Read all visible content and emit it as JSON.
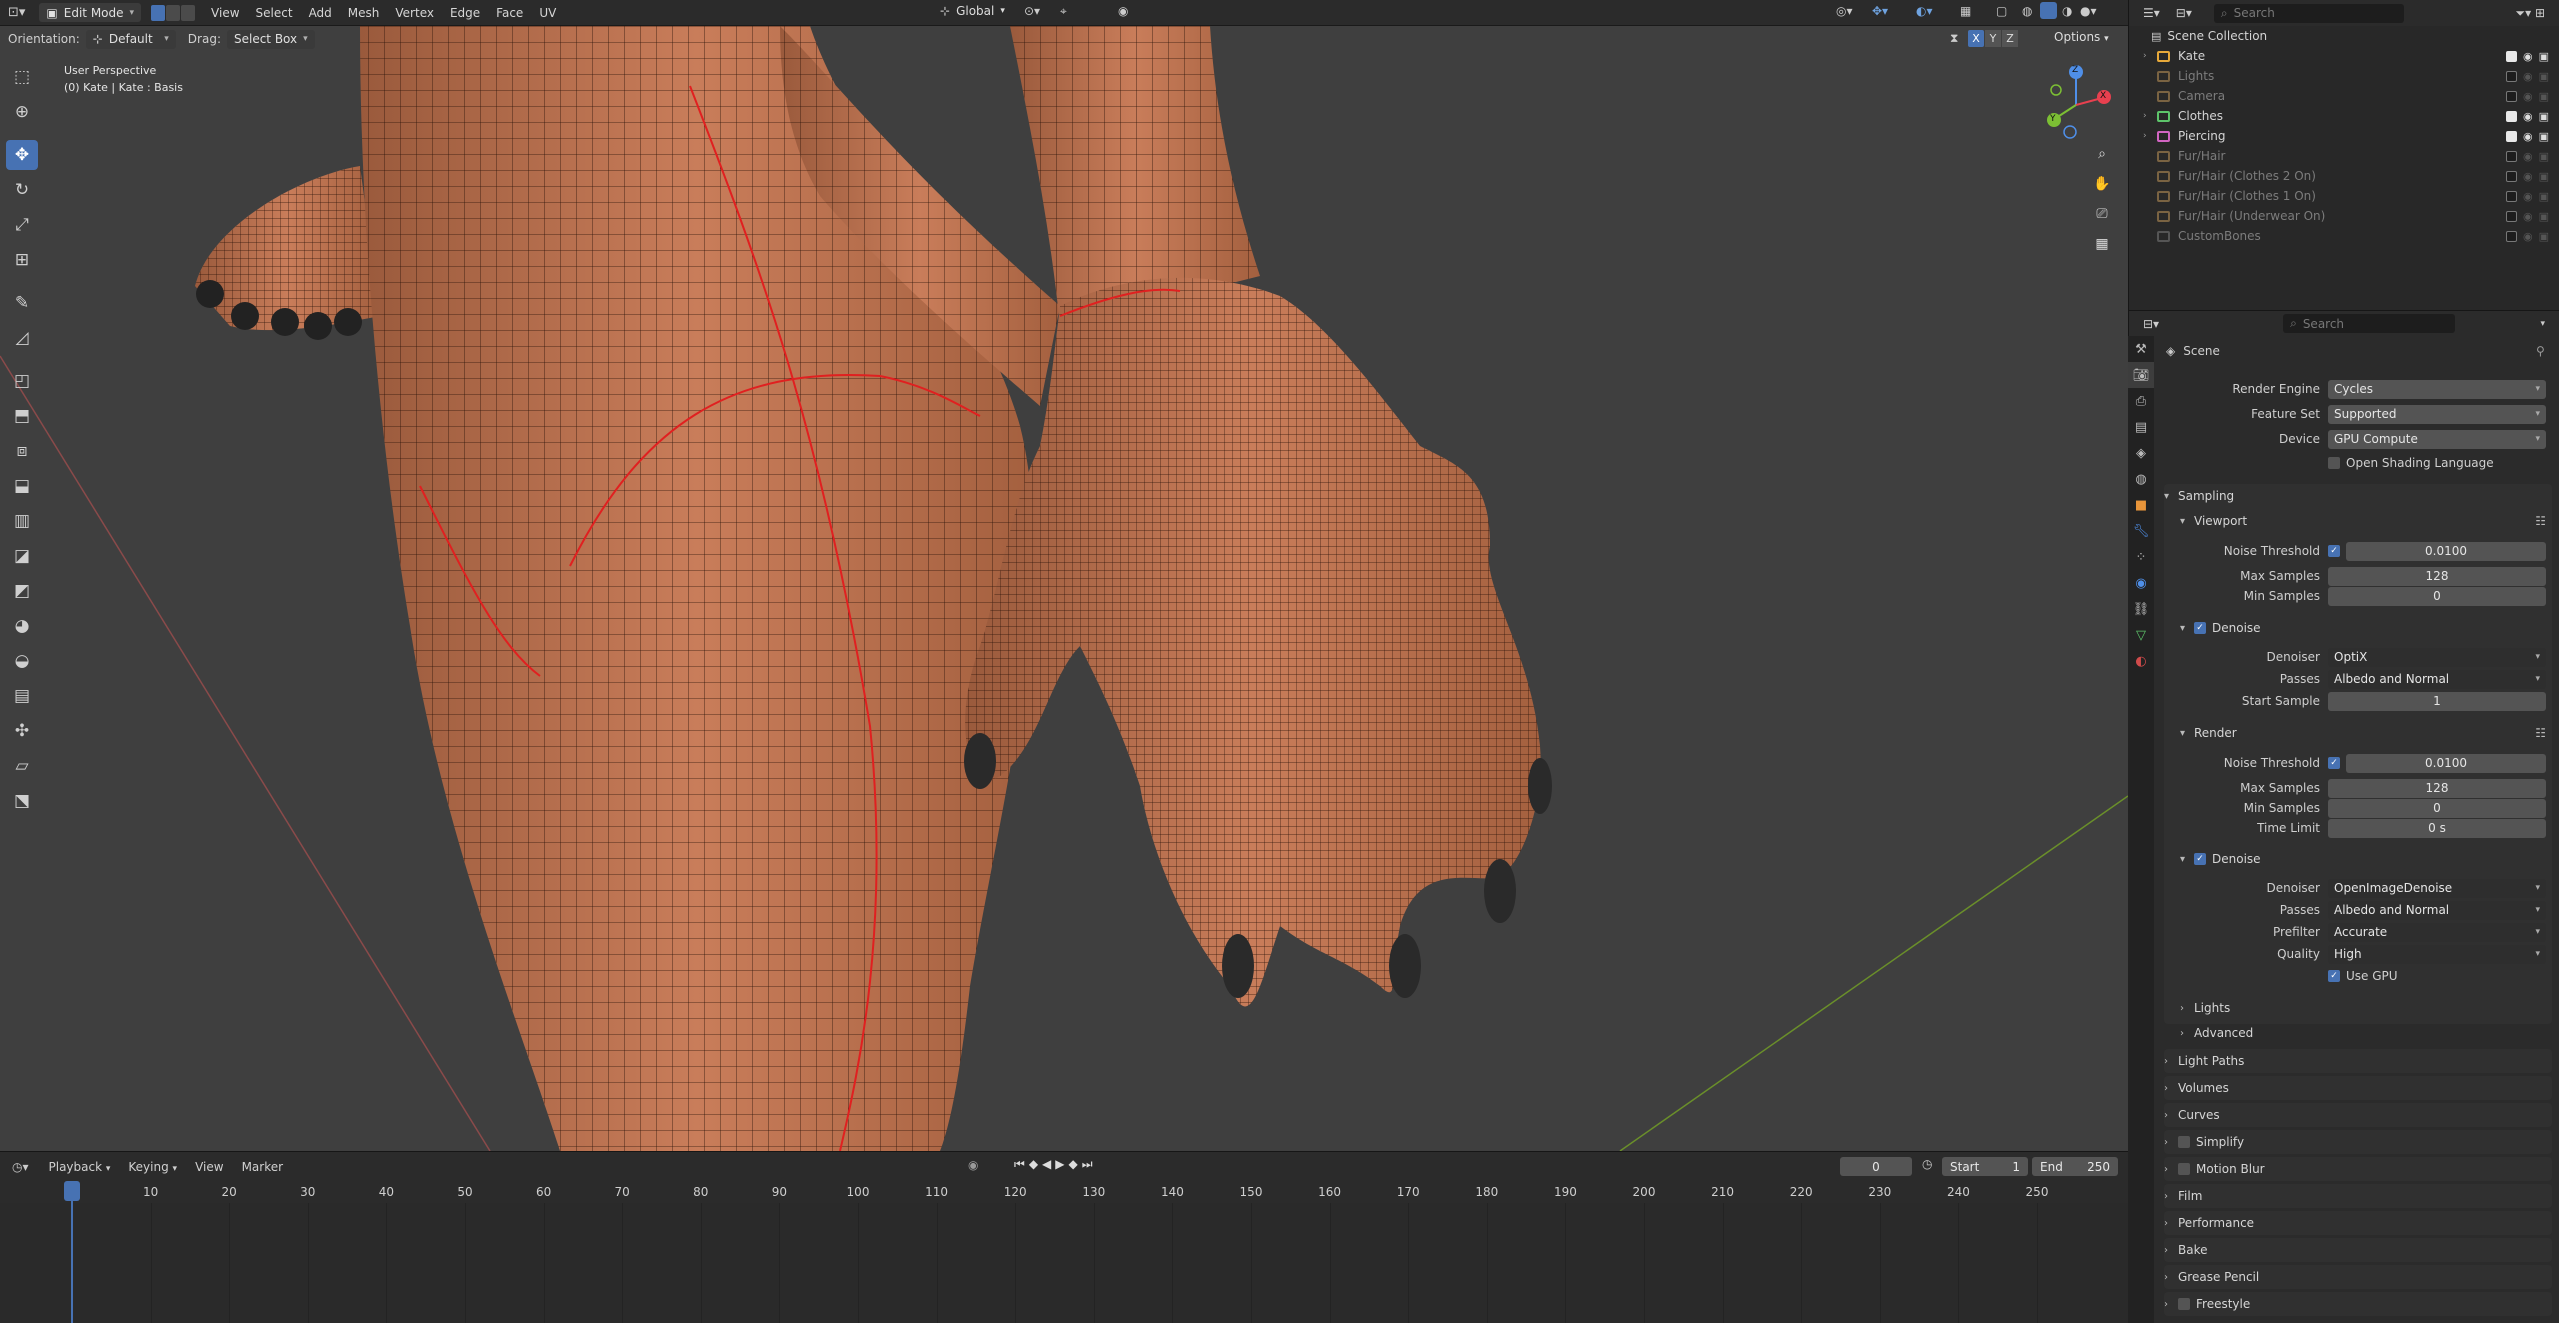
{
  "header": {
    "mode": "Edit Mode",
    "menus": [
      "View",
      "Select",
      "Add",
      "Mesh",
      "Vertex",
      "Edge",
      "Face",
      "UV"
    ],
    "transform_orientation": "Global"
  },
  "tool_header": {
    "orientation_label": "Orientation:",
    "orientation_value": "Default",
    "drag_label": "Drag:",
    "drag_value": "Select Box",
    "axis_x": "X",
    "axis_y": "Y",
    "axis_z": "Z",
    "options_label": "Options"
  },
  "viewport": {
    "perspective": "User Perspective",
    "object_info": "(0) Kate | Kate : Basis"
  },
  "gizmo": {
    "x": "X",
    "y": "Y",
    "z": "Z"
  },
  "timeline": {
    "menus": [
      "Playback",
      "Keying",
      "View",
      "Marker"
    ],
    "current_frame": "0",
    "start_label": "Start",
    "start": "1",
    "end_label": "End",
    "end": "250",
    "ticks": [
      "0",
      "10",
      "20",
      "30",
      "40",
      "50",
      "60",
      "70",
      "80",
      "90",
      "100",
      "110",
      "120",
      "130",
      "140",
      "150",
      "160",
      "170",
      "180",
      "190",
      "200",
      "210",
      "220",
      "230",
      "240",
      "250"
    ]
  },
  "outliner": {
    "search_placeholder": "Search",
    "root": "Scene Collection",
    "items": [
      {
        "label": "Kate",
        "color": "#e7a93a",
        "dim": false,
        "expand": true,
        "visible": true
      },
      {
        "label": "Lights",
        "color": "#7a6342",
        "dim": true,
        "expand": false,
        "visible": false
      },
      {
        "label": "Camera",
        "color": "#7a6342",
        "dim": true,
        "expand": false,
        "visible": false
      },
      {
        "label": "Clothes",
        "color": "#5dc46a",
        "dim": false,
        "expand": true,
        "visible": true
      },
      {
        "label": "Piercing",
        "color": "#d265c2",
        "dim": false,
        "expand": true,
        "visible": true
      },
      {
        "label": "Fur/Hair",
        "color": "#7a6342",
        "dim": true,
        "expand": false,
        "visible": false
      },
      {
        "label": "Fur/Hair (Clothes 2 On)",
        "color": "#7a6342",
        "dim": true,
        "expand": false,
        "visible": false
      },
      {
        "label": "Fur/Hair (Clothes 1 On)",
        "color": "#7a6342",
        "dim": true,
        "expand": false,
        "visible": false
      },
      {
        "label": "Fur/Hair (Underwear On)",
        "color": "#7a6342",
        "dim": true,
        "expand": false,
        "visible": false
      },
      {
        "label": "CustomBones",
        "color": "#555555",
        "dim": true,
        "expand": false,
        "visible": false
      }
    ]
  },
  "properties": {
    "search_placeholder": "Search",
    "context": "Scene",
    "render_engine_label": "Render Engine",
    "render_engine": "Cycles",
    "feature_set_label": "Feature Set",
    "feature_set": "Supported",
    "device_label": "Device",
    "device": "GPU Compute",
    "osl_label": "Open Shading Language",
    "sampling": "Sampling",
    "viewport": "Viewport",
    "vp_noise_label": "Noise Threshold",
    "vp_noise": "0.0100",
    "vp_max_label": "Max Samples",
    "vp_max": "128",
    "vp_min_label": "Min Samples",
    "vp_min": "0",
    "vp_denoise": "Denoise",
    "vp_denoiser_label": "Denoiser",
    "vp_denoiser": "OptiX",
    "vp_passes_label": "Passes",
    "vp_passes": "Albedo and Normal",
    "vp_start_label": "Start Sample",
    "vp_start": "1",
    "render": "Render",
    "r_noise_label": "Noise Threshold",
    "r_noise": "0.0100",
    "r_max_label": "Max Samples",
    "r_max": "128",
    "r_min_label": "Min Samples",
    "r_min": "0",
    "r_time_label": "Time Limit",
    "r_time": "0 s",
    "r_denoise": "Denoise",
    "r_denoiser_label": "Denoiser",
    "r_denoiser": "OpenImageDenoise",
    "r_passes_label": "Passes",
    "r_passes": "Albedo and Normal",
    "r_prefilter_label": "Prefilter",
    "r_prefilter": "Accurate",
    "r_quality_label": "Quality",
    "r_quality": "High",
    "r_use_gpu": "Use GPU",
    "lights": "Lights",
    "advanced": "Advanced",
    "panels": [
      "Light Paths",
      "Volumes",
      "Curves",
      "Simplify",
      "Motion Blur",
      "Film",
      "Performance",
      "Bake",
      "Grease Pencil",
      "Freestyle"
    ]
  }
}
